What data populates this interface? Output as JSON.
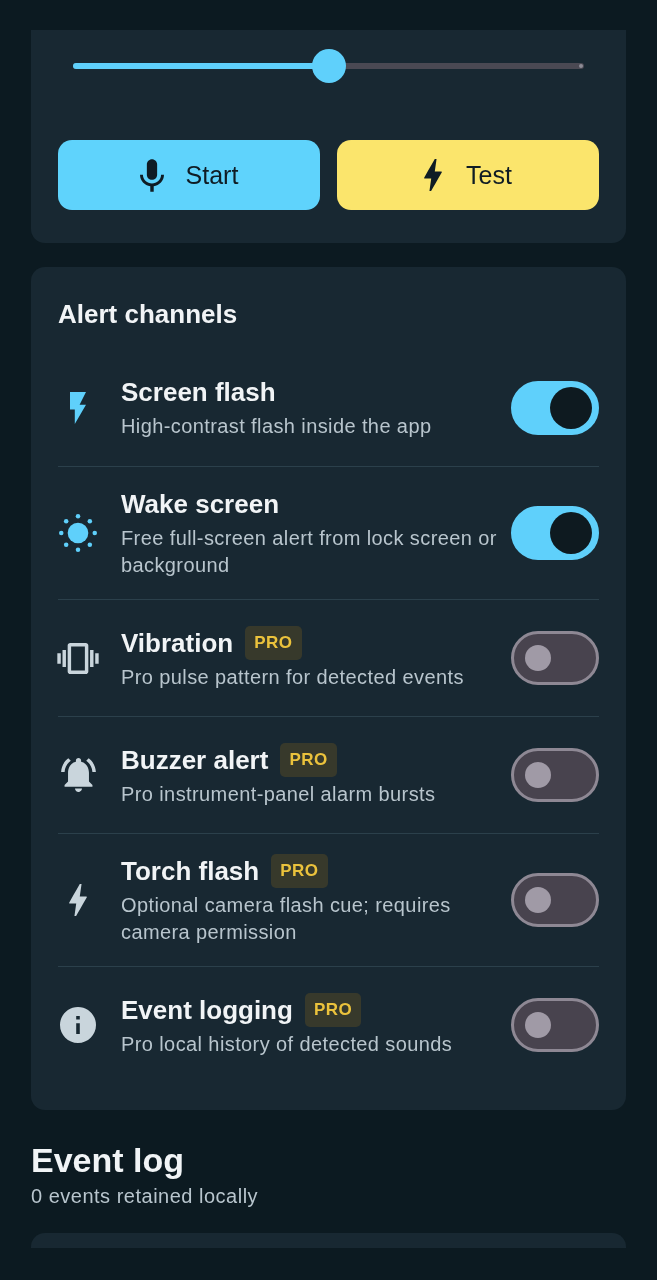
{
  "slider": {
    "level": 0.5
  },
  "buttons": [
    {
      "label": "Start",
      "kind": "record"
    },
    {
      "label": "Test",
      "kind": "test"
    }
  ],
  "alert_channels": {
    "title": "Alert channels",
    "channels": [
      {
        "kind": "flash",
        "title": "Screen flash",
        "description": "High-contrast flash inside the app",
        "on": true
      },
      {
        "kind": "wake",
        "title": "Wake screen",
        "description": "Free full-screen alert from lock screen or background",
        "on": true
      },
      {
        "kind": "vibration",
        "title": "Vibration",
        "badge": "PRO",
        "description": "Pro pulse pattern for detected events",
        "on": false
      },
      {
        "kind": "buzzer",
        "title": "Buzzer alert",
        "badge": "PRO",
        "description": "Pro instrument-panel alarm bursts",
        "on": false
      },
      {
        "kind": "torch",
        "title": "Torch flash",
        "badge": "PRO",
        "description": "Optional camera flash cue; requires camera permission",
        "on": false
      },
      {
        "kind": "logging",
        "title": "Event logging",
        "badge": "PRO",
        "description": "Pro local history of detected sounds",
        "on": false
      }
    ]
  },
  "event_log": {
    "title": "Event log",
    "summary": "0 events retained locally"
  }
}
